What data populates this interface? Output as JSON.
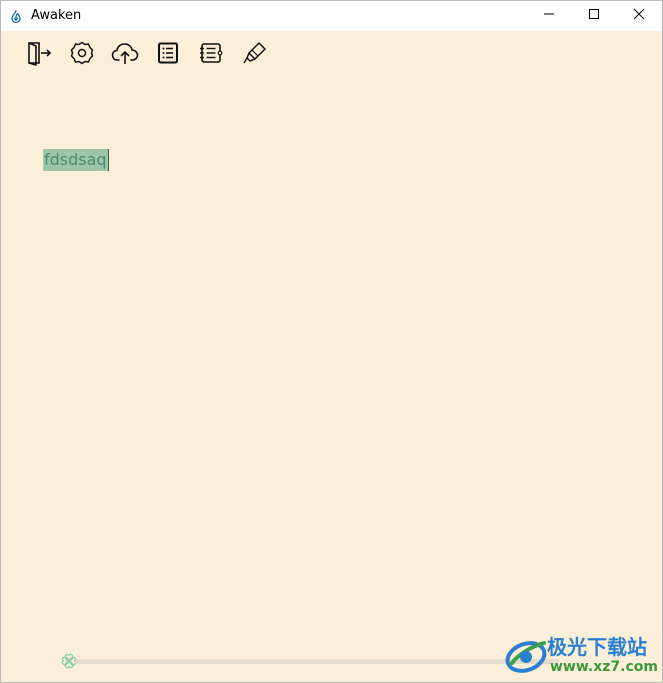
{
  "window": {
    "title": "Awaken",
    "app_icon": "drop-flame-icon",
    "controls": {
      "minimize": "minimize-icon",
      "maximize": "maximize-icon",
      "close": "close-icon"
    }
  },
  "toolbar": {
    "items": [
      {
        "name": "exit-button",
        "icon": "door-exit-icon"
      },
      {
        "name": "settings-button",
        "icon": "gear-icon"
      },
      {
        "name": "upload-button",
        "icon": "cloud-upload-icon"
      },
      {
        "name": "list-button",
        "icon": "list-icon"
      },
      {
        "name": "outline-button",
        "icon": "notebook-icon"
      },
      {
        "name": "highlight-button",
        "icon": "highlighter-icon"
      }
    ]
  },
  "editor": {
    "text": "fdsdsaq",
    "selected": true
  },
  "progress": {
    "icon": "clover-icon",
    "value": 0
  },
  "watermark": {
    "title": "极光下载站",
    "url": "www.xz7.com"
  },
  "colors": {
    "background": "#fbefda",
    "selection": "#9cc7a8",
    "text": "#4c8a6c",
    "clover": "#8fd0a8",
    "track": "#e4dccd"
  }
}
